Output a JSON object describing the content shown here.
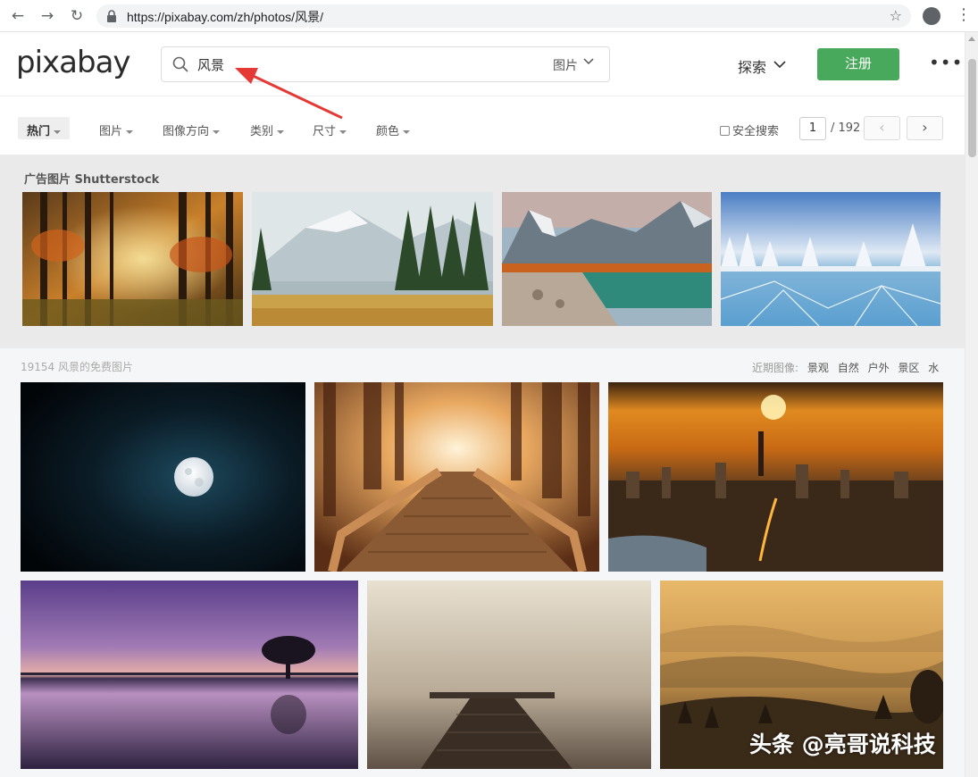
{
  "browser": {
    "url": "https://pixabay.com/zh/photos/风景/"
  },
  "header": {
    "logo": "pixabay",
    "search_value": "风景",
    "search_type": "图片",
    "explore": "探索",
    "signup": "注册",
    "more": "•••"
  },
  "filters": {
    "items": [
      {
        "label": "热门"
      },
      {
        "label": "图片"
      },
      {
        "label": "图像方向"
      },
      {
        "label": "类别"
      },
      {
        "label": "尺寸"
      },
      {
        "label": "颜色"
      }
    ],
    "safesearch": "安全搜索",
    "page_current": "1",
    "page_total": "/ 192",
    "prev": "‹",
    "next": "›"
  },
  "sponsored": {
    "title": "广告图片 Shutterstock"
  },
  "results": {
    "count_text": "19154 风景的免费图片",
    "recent_label": "近期图像:",
    "recent_tags": [
      "景观",
      "自然",
      "户外",
      "景区",
      "水"
    ]
  },
  "watermark": "头条 @亮哥说科技",
  "colors": {
    "signup_green": "#48a85b",
    "arrow_red": "#e53935",
    "sponsored_bg": "#eaeaea"
  }
}
